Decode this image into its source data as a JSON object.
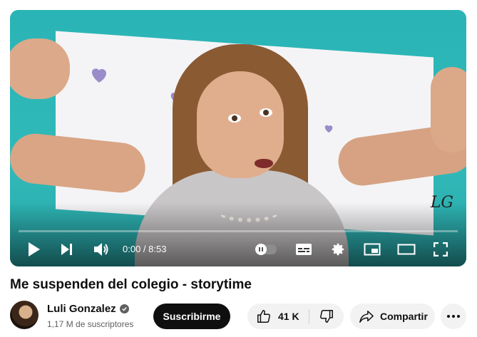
{
  "player": {
    "time_display": "0:00 / 8:53",
    "progress_fraction": 0.0,
    "watermark": "LG",
    "colors": {
      "progress": "#ff0000",
      "controls": "#ffffff"
    }
  },
  "video": {
    "title": "Me suspenden del colegio - storytime"
  },
  "channel": {
    "name": "Luli Gonzalez",
    "subscribers": "1,17 M de suscriptores",
    "verified_icon": "verified-check-icon"
  },
  "actions": {
    "subscribe_label": "Suscribirme",
    "like_count": "41 K",
    "share_label": "Compartir"
  },
  "colors": {
    "subscribe_bg": "#0f0f0f",
    "pill_bg": "#f2f2f2",
    "text_primary": "#0f0f0f",
    "text_secondary": "#606060"
  }
}
